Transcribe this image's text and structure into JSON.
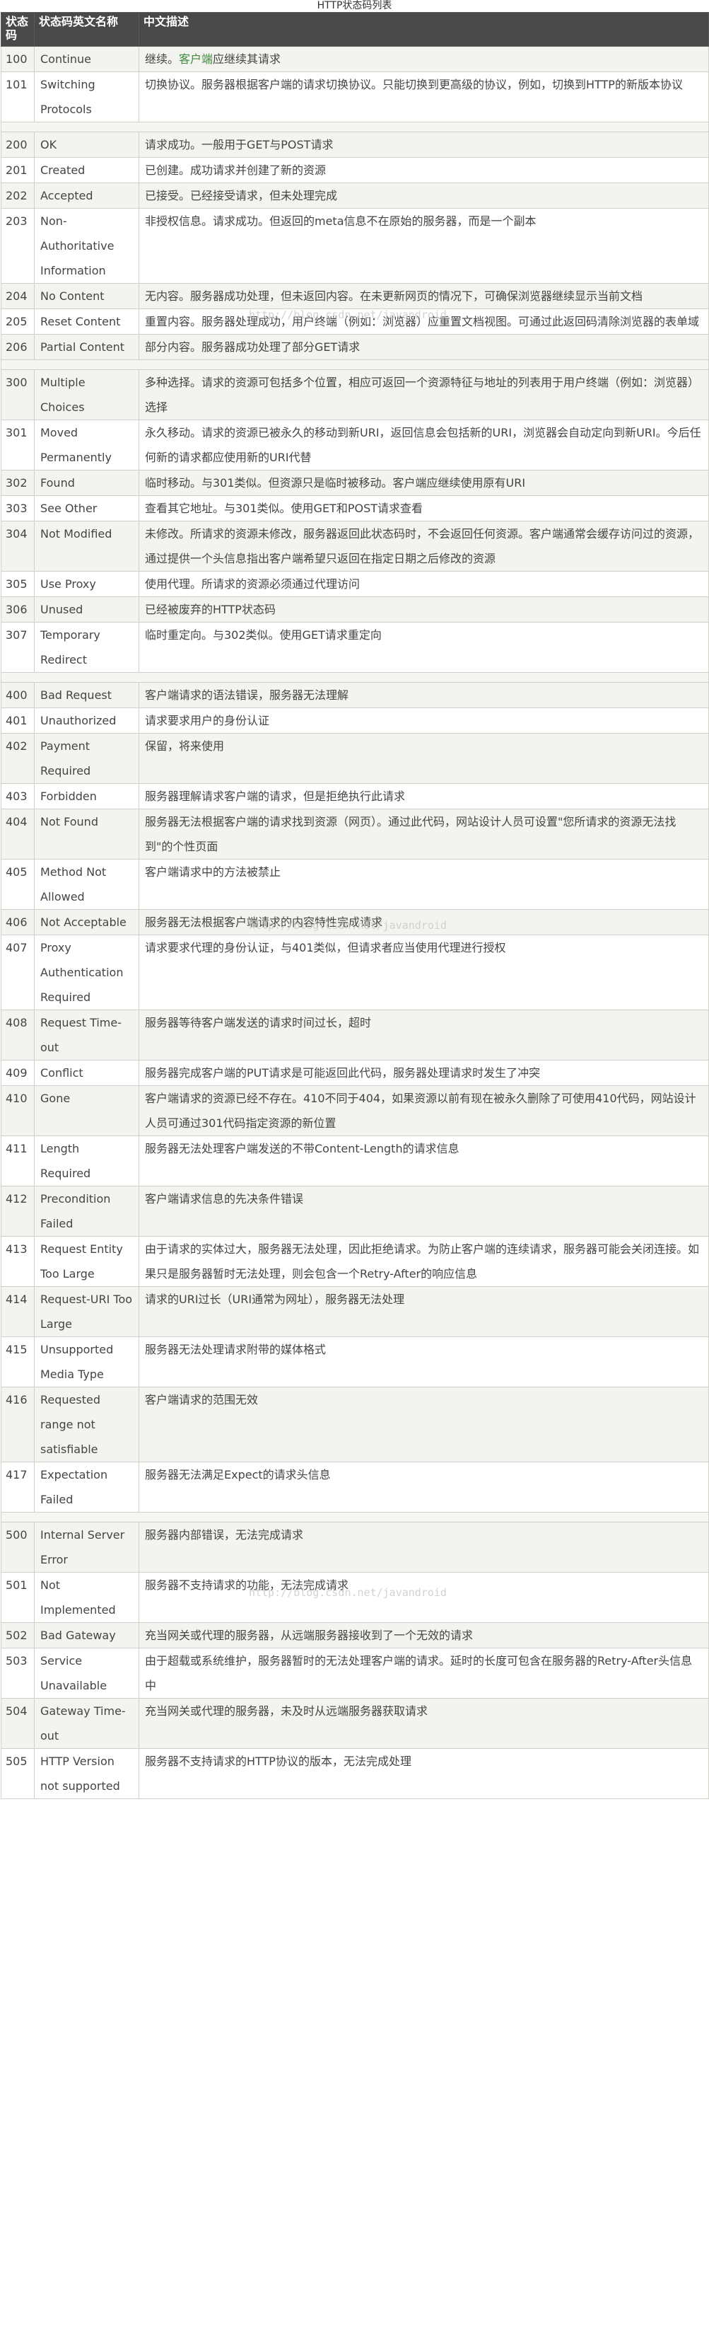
{
  "caption": "HTTP状态码列表",
  "headers": [
    "状态码",
    "状态码英文名称",
    "中文描述"
  ],
  "watermark": "http://blog.csdn.net/javandroid",
  "groups": [
    [
      {
        "code": "100",
        "name": "Continue",
        "desc": "继续。",
        "link": "客户端",
        "desc_after": "应继续其请求"
      },
      {
        "code": "101",
        "name": "Switching Protocols",
        "desc": "切换协议。服务器根据客户端的请求切换协议。只能切换到更高级的协议，例如，切换到HTTP的新版本协议"
      }
    ],
    [
      {
        "code": "200",
        "name": "OK",
        "desc": "请求成功。一般用于GET与POST请求"
      },
      {
        "code": "201",
        "name": "Created",
        "desc": "已创建。成功请求并创建了新的资源"
      },
      {
        "code": "202",
        "name": "Accepted",
        "desc": "已接受。已经接受请求，但未处理完成"
      },
      {
        "code": "203",
        "name": "Non-Authoritative Information",
        "desc": "非授权信息。请求成功。但返回的meta信息不在原始的服务器，而是一个副本"
      },
      {
        "code": "204",
        "name": "No Content",
        "desc": "无内容。服务器成功处理，但未返回内容。在未更新网页的情况下，可确保浏览器继续显示当前文档"
      },
      {
        "code": "205",
        "name": "Reset Content",
        "desc": "重置内容。服务器处理成功，用户终端（例如：浏览器）应重置文档视图。可通过此返回码清除浏览器的表单域"
      },
      {
        "code": "206",
        "name": "Partial Content",
        "desc": "部分内容。服务器成功处理了部分GET请求"
      }
    ],
    [
      {
        "code": "300",
        "name": "Multiple Choices",
        "desc": "多种选择。请求的资源可包括多个位置，相应可返回一个资源特征与地址的列表用于用户终端（例如：浏览器）选择"
      },
      {
        "code": "301",
        "name": "Moved Permanently",
        "desc": "永久移动。请求的资源已被永久的移动到新URI，返回信息会包括新的URI，浏览器会自动定向到新URI。今后任何新的请求都应使用新的URI代替"
      },
      {
        "code": "302",
        "name": "Found",
        "desc": "临时移动。与301类似。但资源只是临时被移动。客户端应继续使用原有URI"
      },
      {
        "code": "303",
        "name": "See Other",
        "desc": "查看其它地址。与301类似。使用GET和POST请求查看"
      },
      {
        "code": "304",
        "name": "Not Modified",
        "desc": "未修改。所请求的资源未修改，服务器返回此状态码时，不会返回任何资源。客户端通常会缓存访问过的资源，通过提供一个头信息指出客户端希望只返回在指定日期之后修改的资源"
      },
      {
        "code": "305",
        "name": "Use Proxy",
        "desc": "使用代理。所请求的资源必须通过代理访问"
      },
      {
        "code": "306",
        "name": "Unused",
        "desc": "已经被废弃的HTTP状态码"
      },
      {
        "code": "307",
        "name": "Temporary Redirect",
        "desc": "临时重定向。与302类似。使用GET请求重定向"
      }
    ],
    [
      {
        "code": "400",
        "name": "Bad Request",
        "desc": "客户端请求的语法错误，服务器无法理解"
      },
      {
        "code": "401",
        "name": "Unauthorized",
        "desc": "请求要求用户的身份认证"
      },
      {
        "code": "402",
        "name": "Payment Required",
        "desc": "保留，将来使用"
      },
      {
        "code": "403",
        "name": "Forbidden",
        "desc": "服务器理解请求客户端的请求，但是拒绝执行此请求"
      },
      {
        "code": "404",
        "name": "Not Found",
        "desc": "服务器无法根据客户端的请求找到资源（网页）。通过此代码，网站设计人员可设置\"您所请求的资源无法找到\"的个性页面"
      },
      {
        "code": "405",
        "name": "Method Not Allowed",
        "desc": "客户端请求中的方法被禁止"
      },
      {
        "code": "406",
        "name": "Not Acceptable",
        "desc": "服务器无法根据客户端请求的内容特性完成请求"
      },
      {
        "code": "407",
        "name": "Proxy Authentication Required",
        "desc": "请求要求代理的身份认证，与401类似，但请求者应当使用代理进行授权"
      },
      {
        "code": "408",
        "name": "Request Time-out",
        "desc": "服务器等待客户端发送的请求时间过长，超时"
      },
      {
        "code": "409",
        "name": "Conflict",
        "desc": "服务器完成客户端的PUT请求是可能返回此代码，服务器处理请求时发生了冲突"
      },
      {
        "code": "410",
        "name": "Gone",
        "desc": "客户端请求的资源已经不存在。410不同于404，如果资源以前有现在被永久删除了可使用410代码，网站设计人员可通过301代码指定资源的新位置"
      },
      {
        "code": "411",
        "name": "Length Required",
        "desc": "服务器无法处理客户端发送的不带Content-Length的请求信息"
      },
      {
        "code": "412",
        "name": "Precondition Failed",
        "desc": "客户端请求信息的先决条件错误"
      },
      {
        "code": "413",
        "name": "Request Entity Too Large",
        "desc": "由于请求的实体过大，服务器无法处理，因此拒绝请求。为防止客户端的连续请求，服务器可能会关闭连接。如果只是服务器暂时无法处理，则会包含一个Retry-After的响应信息"
      },
      {
        "code": "414",
        "name": "Request-URI Too Large",
        "desc": "请求的URI过长（URI通常为网址），服务器无法处理"
      },
      {
        "code": "415",
        "name": "Unsupported Media Type",
        "desc": "服务器无法处理请求附带的媒体格式"
      },
      {
        "code": "416",
        "name": "Requested range not satisfiable",
        "desc": "客户端请求的范围无效"
      },
      {
        "code": "417",
        "name": "Expectation Failed",
        "desc": "服务器无法满足Expect的请求头信息"
      }
    ],
    [
      {
        "code": "500",
        "name": "Internal Server Error",
        "desc": "服务器内部错误，无法完成请求"
      },
      {
        "code": "501",
        "name": "Not Implemented",
        "desc": "服务器不支持请求的功能，无法完成请求"
      },
      {
        "code": "502",
        "name": "Bad Gateway",
        "desc": "充当网关或代理的服务器，从远端服务器接收到了一个无效的请求"
      },
      {
        "code": "503",
        "name": "Service Unavailable",
        "desc": "由于超载或系统维护，服务器暂时的无法处理客户端的请求。延时的长度可包含在服务器的Retry-After头信息中"
      },
      {
        "code": "504",
        "name": "Gateway Time-out",
        "desc": "充当网关或代理的服务器，未及时从远端服务器获取请求"
      },
      {
        "code": "505",
        "name": "HTTP Version not supported",
        "desc": "服务器不支持请求的HTTP协议的版本，无法完成处理"
      }
    ]
  ]
}
